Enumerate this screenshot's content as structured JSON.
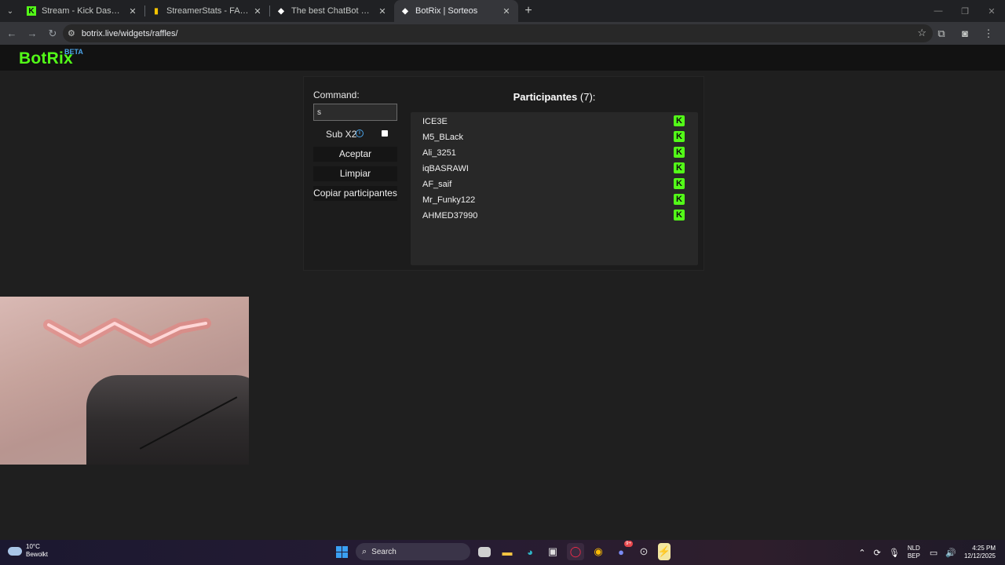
{
  "browser": {
    "tabs": [
      {
        "title": "Stream - Kick Dashboard",
        "favicon": "kick-icon",
        "color": "#53fc18",
        "active": false
      },
      {
        "title": "StreamerStats - FALAFELCO Pro",
        "favicon": "bar-chart-icon",
        "color": "#f5c400",
        "active": false
      },
      {
        "title": "The best ChatBot and Widgets",
        "favicon": "botrix-icon",
        "color": "#ffffff",
        "active": false
      },
      {
        "title": "BotRix | Sorteos",
        "favicon": "botrix-icon",
        "color": "#ffffff",
        "active": true
      }
    ],
    "url": "botrix.live/widgets/raffles/"
  },
  "app": {
    "logo": "BotRix",
    "badge": "BETA",
    "accent": "#53fc18"
  },
  "raffle": {
    "command_label": "Command:",
    "command_value": "s",
    "sub_label": "Sub X2",
    "sub_checked": false,
    "buttons": {
      "accept": "Aceptar",
      "clear": "Limpiar",
      "copy": "Copiar participantes"
    },
    "participants_title": "Participantes",
    "participants_count": "(7):",
    "participants": [
      {
        "name": "ICE3E"
      },
      {
        "name": "M5_BLack"
      },
      {
        "name": "Ali_3251"
      },
      {
        "name": "iqBASRAWI"
      },
      {
        "name": "AF_saif"
      },
      {
        "name": "Mr_Funky122"
      },
      {
        "name": "AHMED37990"
      }
    ]
  },
  "taskbar": {
    "weather_temp": "10°C",
    "weather_desc": "Bewolkt",
    "search": "Search",
    "lang_top": "NLD",
    "lang_bottom": "BEP",
    "time": "4:25 PM",
    "date": "12/12/2025",
    "discord_badge": "9+"
  }
}
